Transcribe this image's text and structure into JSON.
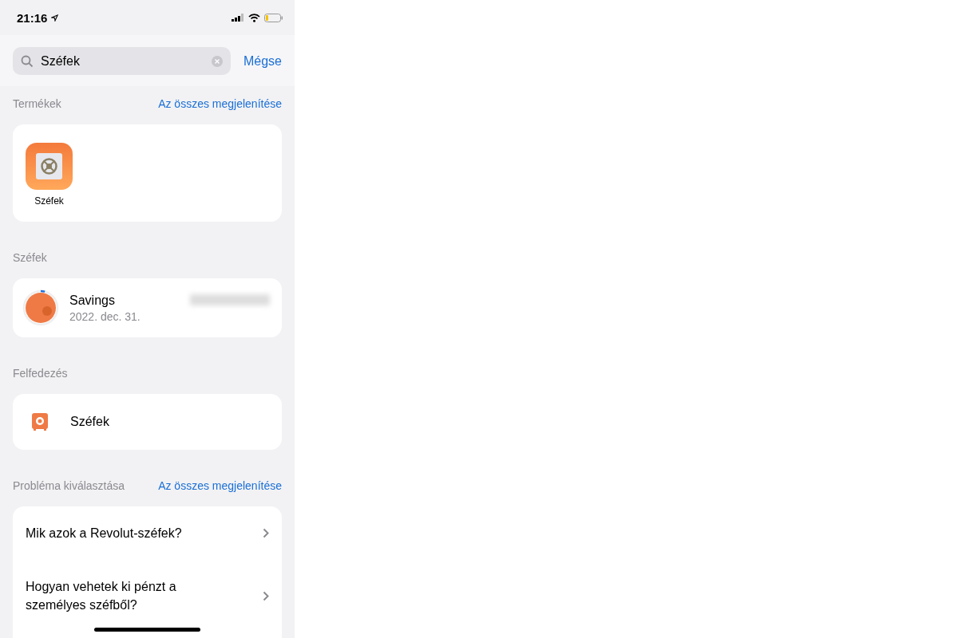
{
  "status_bar": {
    "time": "21:16"
  },
  "search": {
    "value": "Széfek",
    "cancel": "Mégse"
  },
  "products": {
    "heading": "Termékek",
    "show_all": "Az összes megjelenítése",
    "items": [
      {
        "label": "Széfek"
      }
    ]
  },
  "vaults": {
    "heading": "Széfek",
    "items": [
      {
        "name": "Savings",
        "date": "2022. dec. 31.",
        "level": 0.04
      }
    ]
  },
  "discover": {
    "heading": "Felfedezés",
    "items": [
      {
        "label": "Széfek"
      }
    ]
  },
  "problems": {
    "heading": "Probléma kiválasztása",
    "show_all": "Az összes megjelenítése",
    "items": [
      {
        "text": "Mik azok a Revolut-széfek?"
      },
      {
        "text": "Hogyan vehetek ki pénzt a személyes széfből?"
      }
    ]
  }
}
